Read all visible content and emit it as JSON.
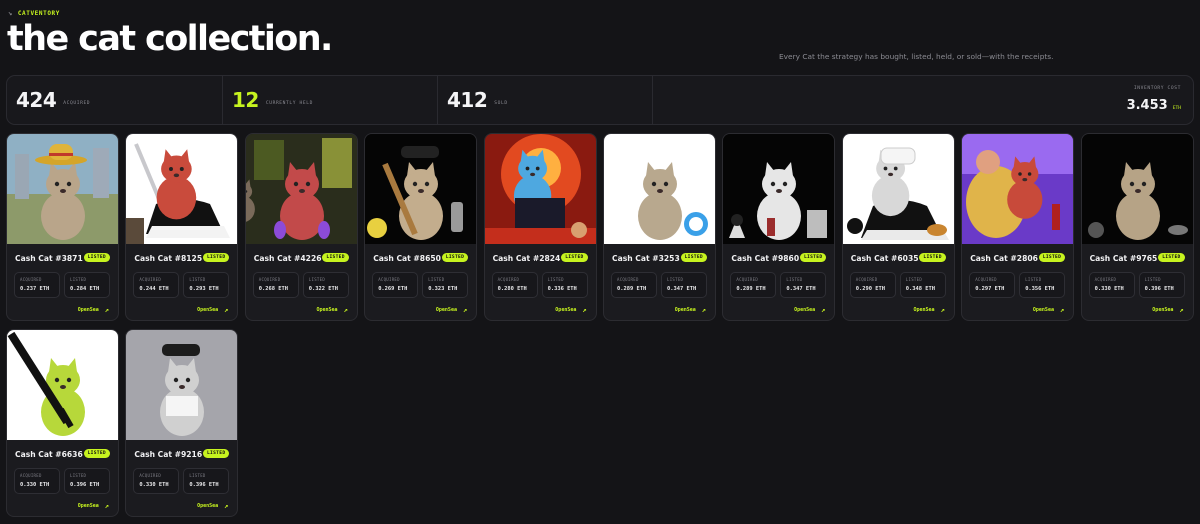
{
  "header": {
    "brand": "CATVENTORY",
    "brand_icon": "paw-icon",
    "title": "the cat collection.",
    "subtitle": "Every Cat the strategy has bought, listed, held, or sold—with the receipts."
  },
  "stats": {
    "acquired": {
      "value": "424",
      "label": "ACQUIRED"
    },
    "held": {
      "value": "12",
      "label": "CURRENTLY HELD"
    },
    "sold": {
      "value": "412",
      "label": "SOLD"
    },
    "inventory": {
      "label": "INVENTORY COST",
      "value": "3.453",
      "unit": "ETH"
    }
  },
  "labels": {
    "listed_badge": "LISTED",
    "acquired": "ACQUIRED",
    "listed": "LISTED",
    "opensea": "OpenSea",
    "arrow": "↗"
  },
  "colors": {
    "accent": "#c6f31f",
    "background": "#141417",
    "card": "#1b1b1f"
  },
  "cats": [
    {
      "name": "Cash Cat #3871",
      "status": "LISTED",
      "acquired": "0.237 ETH",
      "listed": "0.284 ETH",
      "art": "cowboy-hat-cat"
    },
    {
      "name": "Cash Cat #8125",
      "status": "LISTED",
      "acquired": "0.244 ETH",
      "listed": "0.293 ETH",
      "art": "red-maid-cat-with-sword"
    },
    {
      "name": "Cash Cat #4226",
      "status": "LISTED",
      "acquired": "0.268 ETH",
      "listed": "0.322 ETH",
      "art": "red-cat-purple-orbs"
    },
    {
      "name": "Cash Cat #8650",
      "status": "LISTED",
      "acquired": "0.269 ETH",
      "listed": "0.323 ETH",
      "art": "cat-with-bat"
    },
    {
      "name": "Cash Cat #2824",
      "status": "LISTED",
      "acquired": "0.280 ETH",
      "listed": "0.336 ETH",
      "art": "blue-cat-fire"
    },
    {
      "name": "Cash Cat #3253",
      "status": "LISTED",
      "acquired": "0.289 ETH",
      "listed": "0.347 ETH",
      "art": "cat-white-bg"
    },
    {
      "name": "Cash Cat #9860",
      "status": "LISTED",
      "acquired": "0.289 ETH",
      "listed": "0.347 ETH",
      "art": "white-cat-black-bg"
    },
    {
      "name": "Cash Cat #6035",
      "status": "LISTED",
      "acquired": "0.290 ETH",
      "listed": "0.348 ETH",
      "art": "ushanka-maid-cat"
    },
    {
      "name": "Cash Cat #2806",
      "status": "LISTED",
      "acquired": "0.297 ETH",
      "listed": "0.356 ETH",
      "art": "cosmic-cat"
    },
    {
      "name": "Cash Cat #9765",
      "status": "LISTED",
      "acquired": "0.330 ETH",
      "listed": "0.396 ETH",
      "art": "cat-black-bg"
    },
    {
      "name": "Cash Cat #6636",
      "status": "LISTED",
      "acquired": "0.330 ETH",
      "listed": "0.396 ETH",
      "art": "green-cat-big-sword"
    },
    {
      "name": "Cash Cat #9216",
      "status": "LISTED",
      "acquired": "0.330 ETH",
      "listed": "0.396 ETH",
      "art": "stop-cat-cap"
    }
  ]
}
